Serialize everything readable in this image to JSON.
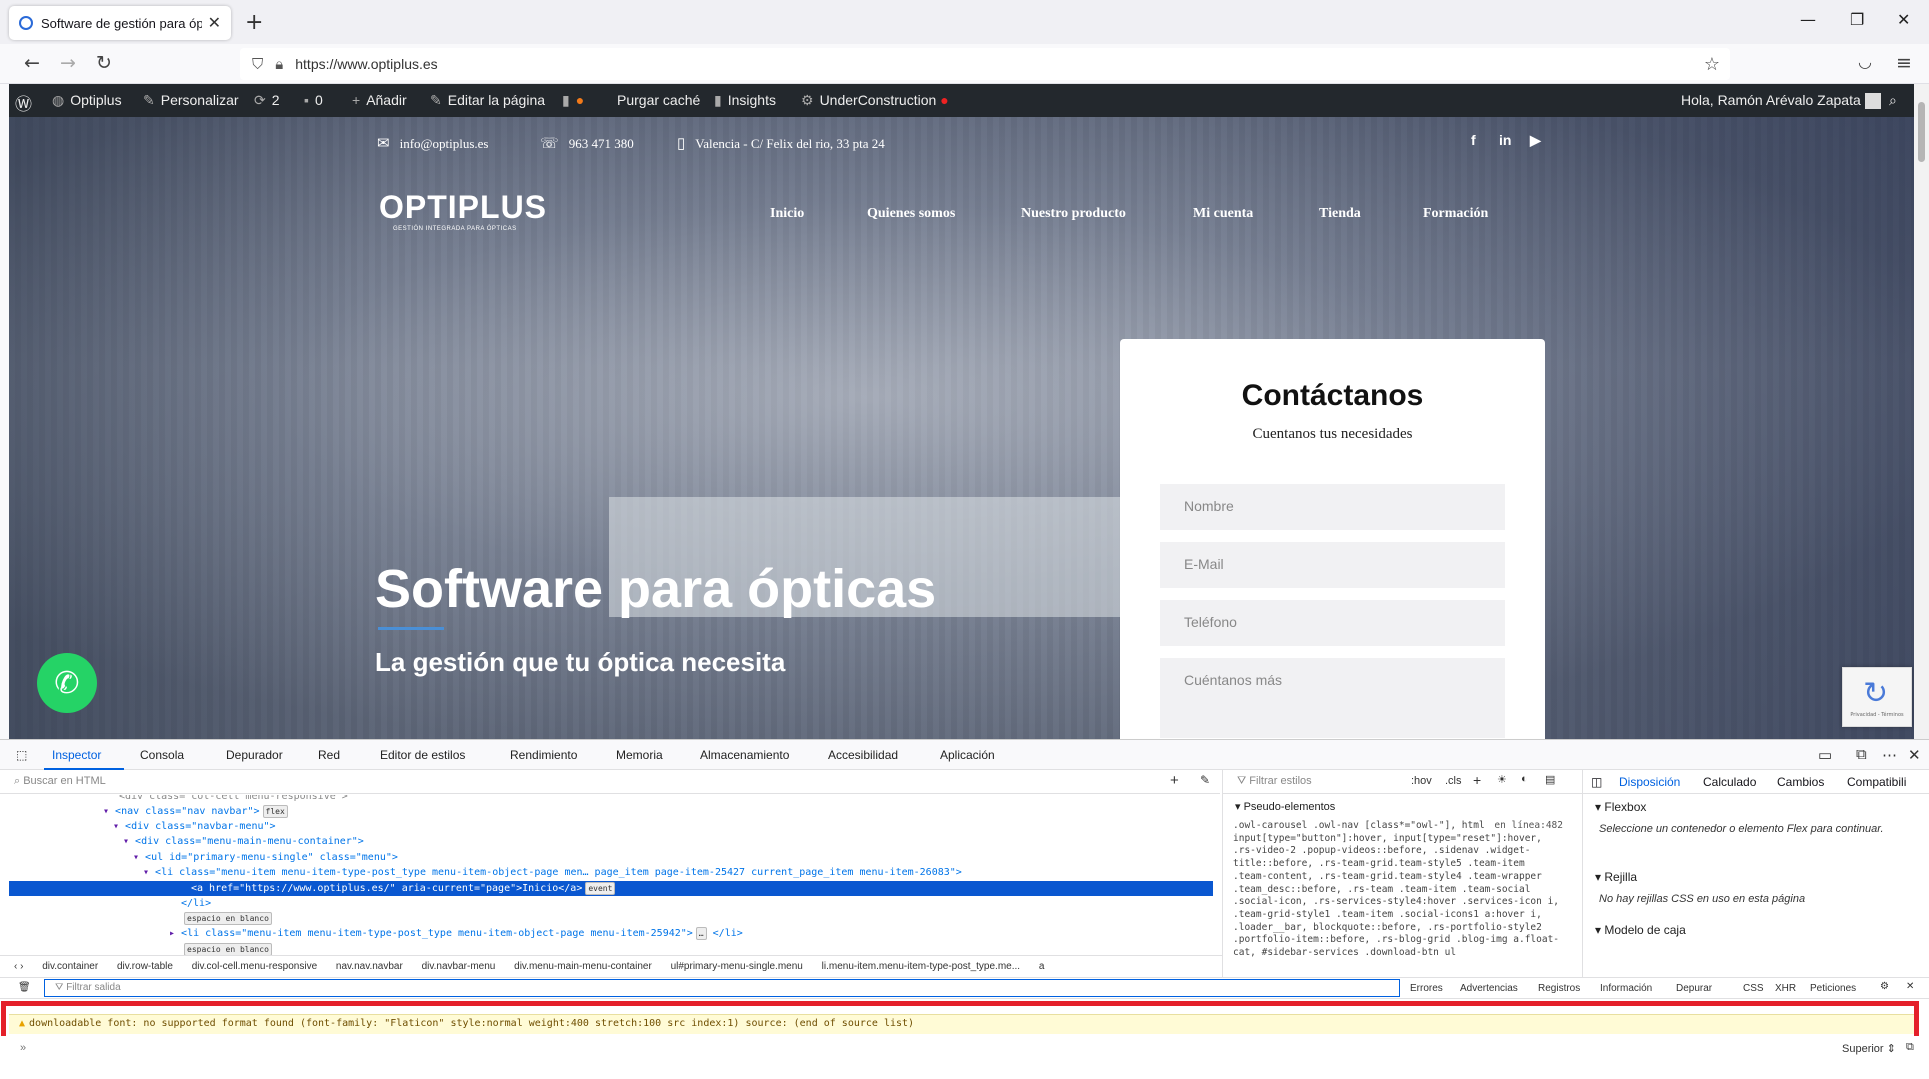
{
  "browser": {
    "tab_title": "Software de gestión para óptica",
    "url": "https://www.optiplus.es"
  },
  "wpbar": {
    "site": "Optiplus",
    "customize": "Personalizar",
    "updates": "2",
    "comments": "0",
    "add": "Añadir",
    "edit": "Editar la página",
    "purge": "Purgar caché",
    "insights": "Insights",
    "under": "UnderConstruction",
    "greeting": "Hola, Ramón Arévalo Zapata"
  },
  "site": {
    "email": "info@optiplus.es",
    "phone": "963 471 380",
    "address": "Valencia - C/ Felix del rio, 33 pta 24",
    "logo_main": "OPTIPLUS",
    "logo_sub": "GESTIÓN INTEGRADA PARA ÓPTICAS",
    "menu": [
      "Inicio",
      "Quienes somos",
      "Nuestro producto",
      "Mi cuenta",
      "Tienda",
      "Formación"
    ],
    "hero_title": "Software para ópticas",
    "hero_sub": "La gestión que tu óptica necesita",
    "contact_title": "Contáctanos",
    "contact_sub": "Cuentanos tus necesidades",
    "fields": [
      "Nombre",
      "E-Mail",
      "Teléfono",
      "Cuéntanos más"
    ],
    "recaptcha": "Privacidad - Términos"
  },
  "devtools": {
    "tabs": [
      "Inspector",
      "Consola",
      "Depurador",
      "Red",
      "Editor de estilos",
      "Rendimiento",
      "Memoria",
      "Almacenamiento",
      "Accesibilidad",
      "Aplicación"
    ],
    "search_placeholder": "Buscar en HTML",
    "styles_filter": "Filtrar estilos",
    "styles_hov": ":hov",
    "styles_cls": ".cls",
    "pseudo": "Pseudo-elementos",
    "css_rule": ".owl-carousel .owl-nav [class*=\"owl-\"], html input[type=\"button\"]:hover, input[type=\"reset\"]:hover, .rs-video-2 .popup-videos::before, .sidenav .widget-title::before, .rs-team-grid.team-style5 .team-item .team-content, .rs-team-grid.team-style4 .team-wrapper .team_desc::before, .rs-team .team-item .team-social .social-icon, .rs-services-style4:hover .services-icon i, .team-grid-style1 .team-item .social-icons1 a:hover i, .loader__bar, blockquote::before, .rs-portfolio-style2 .portfolio-item::before, .rs-blog-grid .blog-img a.float-cat, #sidebar-services .download-btn ul",
    "css_source": "en línea:482",
    "layout_tabs": [
      "Disposición",
      "Calculado",
      "Cambios",
      "Compatibili"
    ],
    "flexbox": "Flexbox",
    "flexbox_msg": "Seleccione un contenedor o elemento Flex para continuar.",
    "grid": "Rejilla",
    "grid_msg": "No hay rejillas CSS en uso en esta página",
    "boxmodel": "Modelo de caja",
    "breadcrumb": [
      "div.container",
      "div.row-table",
      "div.col-cell.menu-responsive",
      "nav.nav.navbar",
      "div.navbar-menu",
      "div.menu-main-menu-container",
      "ul#primary-menu-single.menu",
      "li.menu-item.menu-item-type-post_type.me...",
      "a"
    ],
    "console_placeholder": "Filtrar salida",
    "console_filters": [
      "Errores",
      "Advertencias",
      "Registros",
      "Información",
      "Depurar",
      "CSS",
      "XHR",
      "Peticiones"
    ],
    "warning": "downloadable font: no supported format found (font-family: \"Flaticon\" style:normal weight:400 stretch:100 src index:1) source: (end of source list)",
    "bottom_right": "Superior"
  },
  "html_tree": [
    {
      "text": "<div class=\"col-cell menu-responsive\">"
    },
    {
      "text": "<nav class=\"nav navbar\">",
      "badge": "flex"
    },
    {
      "text": "<div class=\"navbar-menu\">"
    },
    {
      "text": "<div class=\"menu-main-menu-container\">"
    },
    {
      "text": "<ul id=\"primary-menu-single\" class=\"menu\">"
    },
    {
      "text": "<li class=\"menu-item menu-item-type-post_type menu-item-object-page men… page_item page-item-25427 current_page_item menu-item-26083\">"
    },
    {
      "text": "<a href=\"https://www.optiplus.es/\" aria-current=\"page\">Inicio</a>",
      "badge": "event"
    },
    {
      "text": "</li>"
    },
    {
      "text": "espacio en blanco"
    },
    {
      "text": "<li class=\"menu-item menu-item-type-post_type menu-item-object-page menu-item-25942\">",
      "badge": "…"
    },
    {
      "text": "</li>"
    },
    {
      "text": "espacio en blanco"
    }
  ]
}
